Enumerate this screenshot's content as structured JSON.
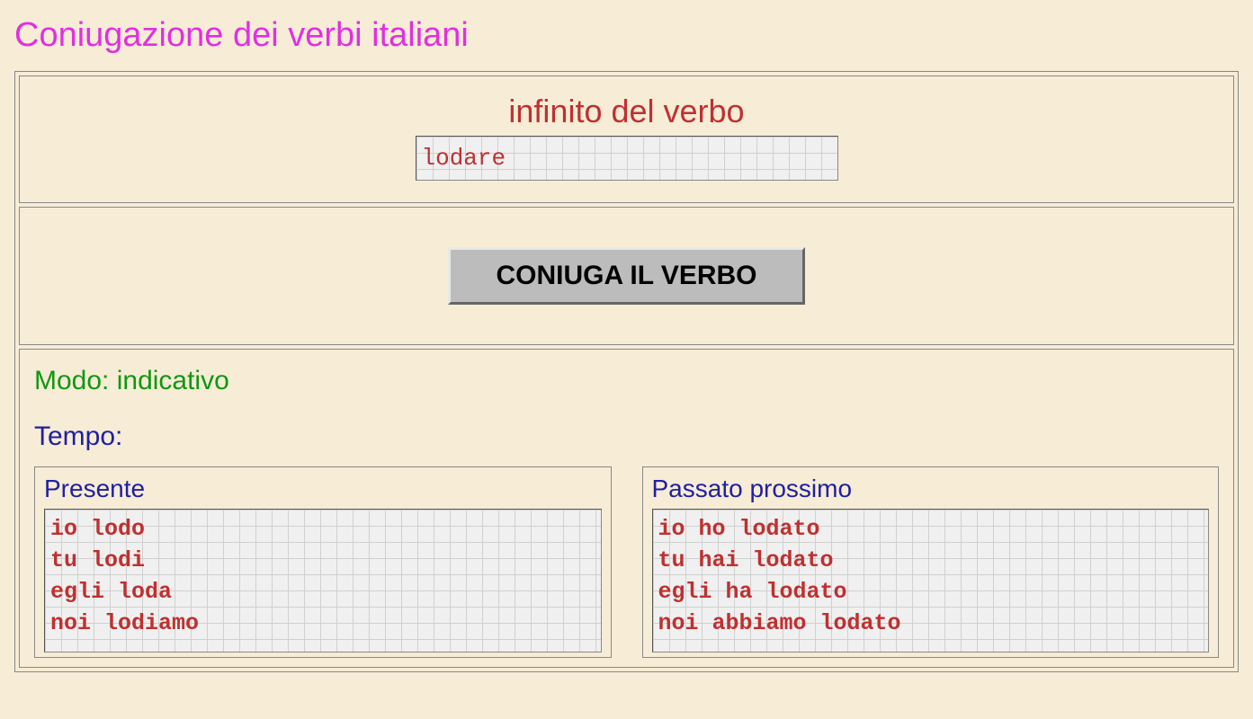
{
  "page": {
    "title": "Coniugazione dei verbi italiani"
  },
  "infinitive": {
    "label": "infinito del verbo",
    "value": "lodare"
  },
  "button": {
    "label": "CONIUGA IL VERBO"
  },
  "results": {
    "modo": "Modo: indicativo",
    "tempo": "Tempo:",
    "tenses": [
      {
        "title": "Presente",
        "lines": "io lodo\ntu lodi\negli loda\nnoi lodiamo"
      },
      {
        "title": "Passato prossimo",
        "lines": "io ho lodato\ntu hai lodato\negli ha lodato\nnoi abbiamo lodato"
      }
    ]
  }
}
